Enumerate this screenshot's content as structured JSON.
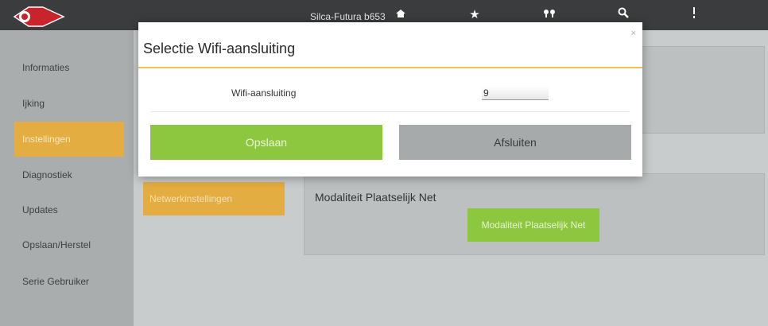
{
  "header": {
    "app_title": "Silca-Futura b653",
    "logo_text": "SILCA",
    "icons": [
      "home-icon",
      "star-icon",
      "key-icon",
      "search-icon",
      "more-vertical-icon"
    ]
  },
  "sidebar": {
    "items": [
      {
        "label": "Informaties"
      },
      {
        "label": "Ijking"
      },
      {
        "label": "Instellingen",
        "active": true
      },
      {
        "label": "Diagnostiek"
      },
      {
        "label": "Updates"
      },
      {
        "label": "Opslaan/Herstel"
      },
      {
        "label": "Serie Gebruiker"
      }
    ]
  },
  "main": {
    "section_button": "Netwerkinstellingen",
    "modality_label": "Modaliteit Plaatselijk Net",
    "modality_button": "Modaliteit Plaatselijk Net"
  },
  "dialog": {
    "title": "Selectie Wifi-aansluiting",
    "close": "×",
    "field_label": "Wifi-aansluiting",
    "field_value": "9",
    "save_label": "Opslaan",
    "close_label": "Afsluiten"
  },
  "colors": {
    "accent": "#e3ad41",
    "green": "#8dc63f",
    "grey_button": "#a6aaab",
    "topbar": "#3a3c3d"
  }
}
